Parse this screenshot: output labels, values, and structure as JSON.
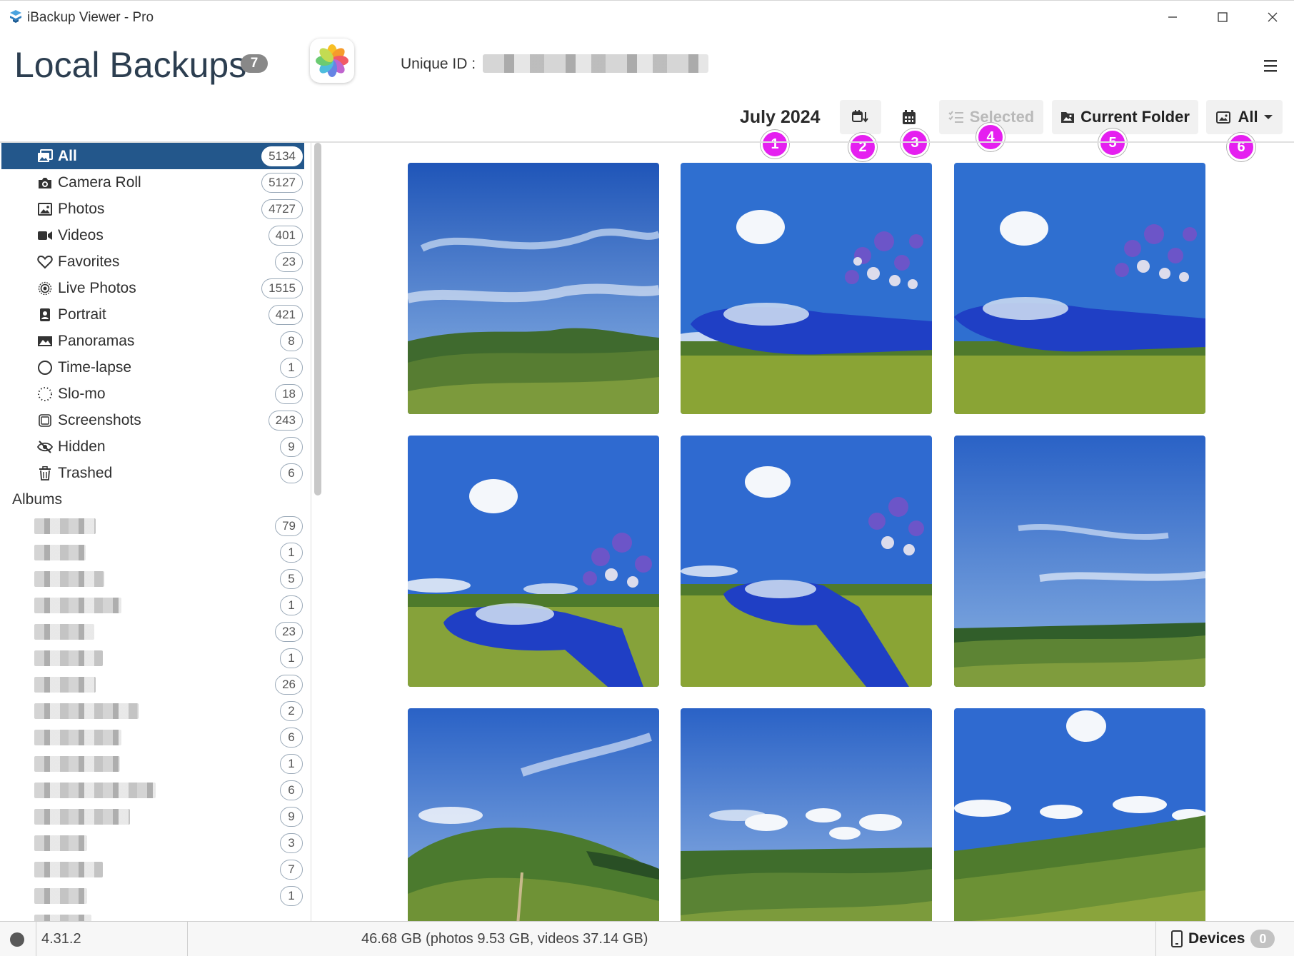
{
  "window": {
    "title": "iBackup Viewer - Pro",
    "controls": [
      "minimize-icon",
      "maximize-icon",
      "close-icon"
    ]
  },
  "header": {
    "title": "Local Backups",
    "backup_count": "7",
    "unique_id_label": "Unique ID :",
    "app_icon": "photos-app-icon",
    "menu_icon": "hamburger-menu-icon"
  },
  "toolbar": {
    "month": "July 2024",
    "sort_icon": "calendar-sort-icon",
    "calendar_icon": "calendar-icon",
    "selected_label": "Selected",
    "current_folder_label": "Current Folder",
    "filter_label": "All"
  },
  "markers": [
    "1",
    "2",
    "3",
    "4",
    "5",
    "6"
  ],
  "sidebar": {
    "items": [
      {
        "label": "All",
        "count": "5134",
        "icon": "photos-stack-icon",
        "active": true
      },
      {
        "label": "Camera Roll",
        "count": "5127",
        "icon": "camera-icon"
      },
      {
        "label": "Photos",
        "count": "4727",
        "icon": "image-icon"
      },
      {
        "label": "Videos",
        "count": "401",
        "icon": "video-camera-icon"
      },
      {
        "label": "Favorites",
        "count": "23",
        "icon": "heart-icon"
      },
      {
        "label": "Live Photos",
        "count": "1515",
        "icon": "live-photo-icon"
      },
      {
        "label": "Portrait",
        "count": "421",
        "icon": "portrait-icon"
      },
      {
        "label": "Panoramas",
        "count": "8",
        "icon": "panorama-icon"
      },
      {
        "label": "Time-lapse",
        "count": "1",
        "icon": "timelapse-icon"
      },
      {
        "label": "Slo-mo",
        "count": "18",
        "icon": "slomo-icon"
      },
      {
        "label": "Screenshots",
        "count": "243",
        "icon": "screenshot-icon"
      },
      {
        "label": "Hidden",
        "count": "9",
        "icon": "eye-slash-icon"
      },
      {
        "label": "Trashed",
        "count": "6",
        "icon": "trash-icon"
      }
    ],
    "albums_heading": "Albums",
    "albums": [
      {
        "count": "79"
      },
      {
        "count": "1"
      },
      {
        "count": "5"
      },
      {
        "count": "1"
      },
      {
        "count": "23"
      },
      {
        "count": "1"
      },
      {
        "count": "26"
      },
      {
        "count": "2"
      },
      {
        "count": "6"
      },
      {
        "count": "1"
      },
      {
        "count": "6"
      },
      {
        "count": "9"
      },
      {
        "count": "3"
      },
      {
        "count": "7"
      },
      {
        "count": "1"
      }
    ]
  },
  "gallery": {
    "photos": [
      {
        "scene": "sky-and-hills"
      },
      {
        "scene": "glider-with-flowers"
      },
      {
        "scene": "glider-with-flowers"
      },
      {
        "scene": "glider-with-flowers"
      },
      {
        "scene": "glider-on-grass"
      },
      {
        "scene": "sky-and-plain"
      },
      {
        "scene": "hill-with-path"
      },
      {
        "scene": "valley-clouds"
      },
      {
        "scene": "meadow-clouds"
      }
    ]
  },
  "status": {
    "version": "4.31.2",
    "storage": "46.68 GB (photos 9.53 GB, videos 37.14 GB)",
    "devices_label": "Devices",
    "devices_count": "0"
  }
}
